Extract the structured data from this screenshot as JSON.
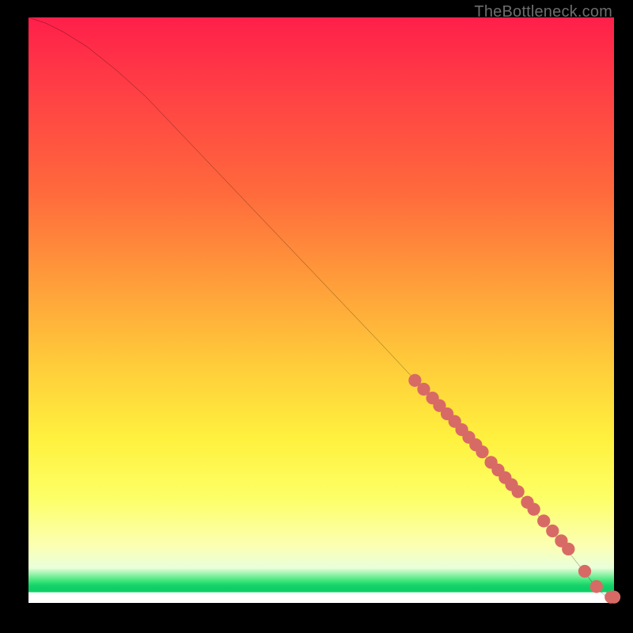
{
  "watermark": "TheBottleneck.com",
  "chart_data": {
    "type": "line",
    "title": "",
    "xlabel": "",
    "ylabel": "",
    "xlim": [
      0,
      100
    ],
    "ylim": [
      0,
      100
    ],
    "curve": {
      "x": [
        0,
        3,
        6,
        10,
        15,
        20,
        30,
        40,
        50,
        60,
        70,
        78,
        84,
        88,
        92,
        95,
        97,
        98.5,
        100
      ],
      "y": [
        100,
        99,
        97.5,
        95,
        91,
        86.5,
        76,
        65.5,
        55,
        44.5,
        33.8,
        25,
        18.5,
        13.8,
        9,
        5.2,
        2.6,
        1.2,
        1.0
      ]
    },
    "markers": {
      "color": "#d86a66",
      "radius": 1.1,
      "x": [
        66,
        67.5,
        69,
        70.2,
        71.5,
        72.8,
        74,
        75.2,
        76.4,
        77.5,
        79,
        80.2,
        81.4,
        82.5,
        83.6,
        85.2,
        86.3,
        88,
        89.5,
        91,
        92.2,
        95,
        97,
        99.5,
        100
      ],
      "y": [
        38,
        36.5,
        35,
        33.7,
        32.3,
        31,
        29.6,
        28.3,
        27,
        25.8,
        24,
        22.7,
        21.4,
        20.2,
        19,
        17.2,
        16,
        14,
        12.3,
        10.6,
        9.2,
        5.4,
        2.8,
        1.0,
        1.0
      ]
    }
  }
}
